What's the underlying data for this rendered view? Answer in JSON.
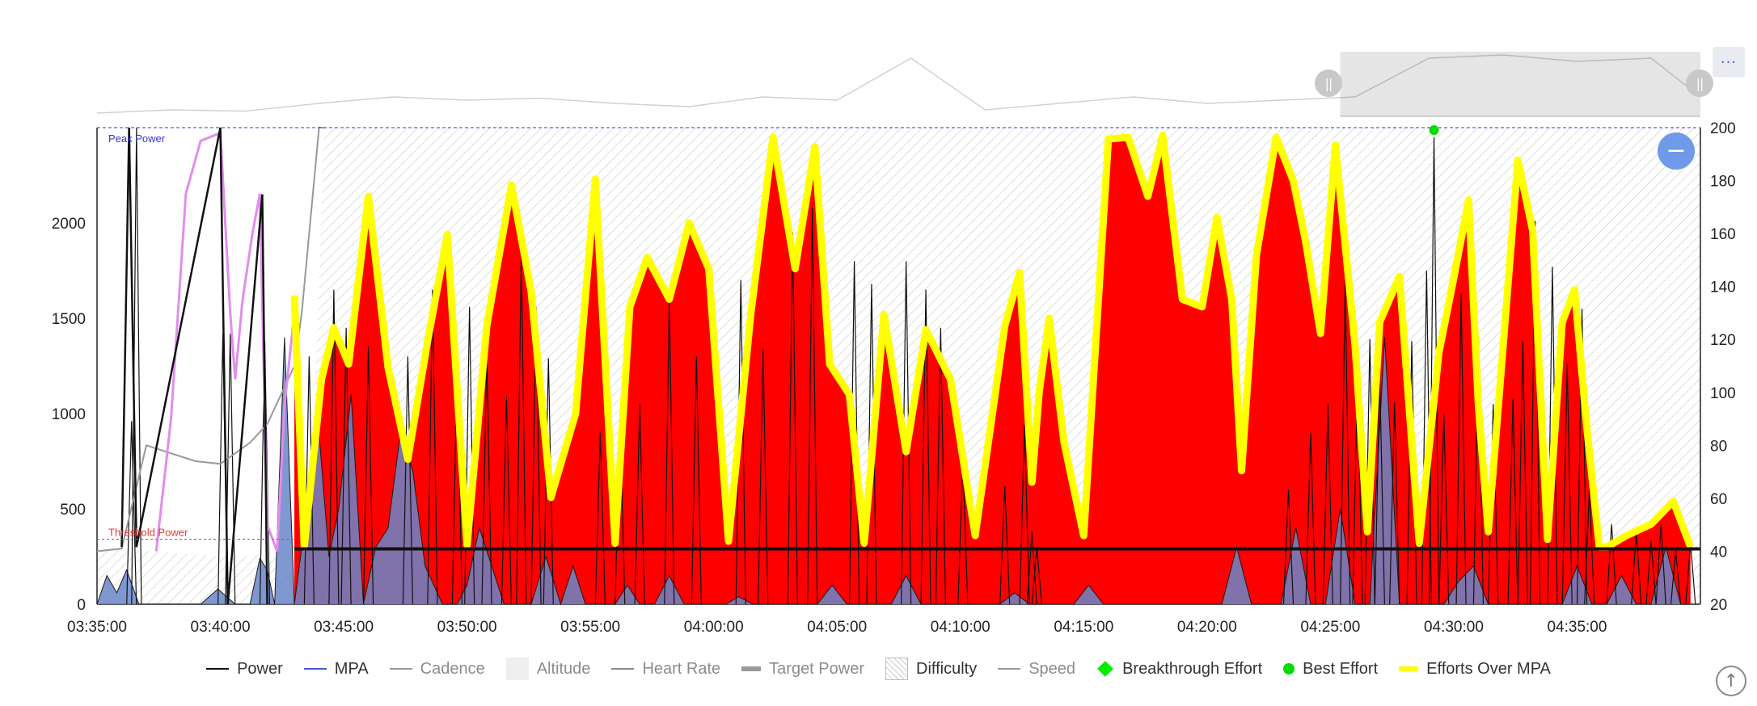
{
  "ui": {
    "menu_label": "···",
    "zoom_out_label": "−",
    "scroll_top_label": "↑",
    "handle_label": "||"
  },
  "colors": {
    "power": "#111111",
    "mpa": "#4a5bd4",
    "cadence": "#999999",
    "altitude": "#eeeeee",
    "heart_rate": "#8a8a8a",
    "target_power": "#9a9a9a",
    "speed": "#9a9a9a",
    "efforts_over_mpa": "#ffff00",
    "effort_fill": "#ff0000",
    "breakthrough": "#00ee00",
    "best_effort": "#00dd00",
    "threshold": "#e53935",
    "peak": "#3333cc",
    "hr_curve": "#e38cf0"
  },
  "legend": [
    {
      "key": "power",
      "label": "Power",
      "swatch": "line",
      "muted": false
    },
    {
      "key": "mpa",
      "label": "MPA",
      "swatch": "line",
      "muted": false
    },
    {
      "key": "cadence",
      "label": "Cadence",
      "swatch": "line",
      "muted": true
    },
    {
      "key": "altitude",
      "label": "Altitude",
      "swatch": "box",
      "muted": true
    },
    {
      "key": "heart_rate",
      "label": "Heart Rate",
      "swatch": "line",
      "muted": true
    },
    {
      "key": "target_power",
      "label": "Target Power",
      "swatch": "thick",
      "muted": true
    },
    {
      "key": "difficulty",
      "label": "Difficulty",
      "swatch": "hatch",
      "muted": false
    },
    {
      "key": "speed",
      "label": "Speed",
      "swatch": "line",
      "muted": true
    },
    {
      "key": "breakthrough",
      "label": "Breakthrough Effort",
      "swatch": "diamond",
      "muted": false
    },
    {
      "key": "best_effort",
      "label": "Best Effort",
      "swatch": "circle",
      "muted": false
    },
    {
      "key": "efforts_over_mpa",
      "label": "Efforts Over MPA",
      "swatch": "thick",
      "muted": false
    }
  ],
  "chart_data": {
    "type": "area",
    "x_axis": {
      "ticks": [
        "03:35:00",
        "03:40:00",
        "03:45:00",
        "03:50:00",
        "03:55:00",
        "04:00:00",
        "04:05:00",
        "04:10:00",
        "04:15:00",
        "04:20:00",
        "04:25:00",
        "04:30:00",
        "04:35:00"
      ],
      "start_min": 0,
      "end_min": 65
    },
    "y_axis_left": {
      "ticks": [
        0,
        500,
        1000,
        1500,
        2000
      ],
      "ylim": [
        0,
        2500
      ]
    },
    "y_axis_right": {
      "ticks": [
        20,
        40,
        60,
        80,
        100,
        120,
        140,
        160,
        180,
        200
      ],
      "ylim": [
        20,
        200
      ]
    },
    "threshold_power": {
      "label": "Threshold Power",
      "value": 290
    },
    "peak_power": {
      "label": "Peak Power",
      "value": 2500
    },
    "efforts_over_mpa": {
      "x": [
        8.0,
        8.4,
        9.1,
        9.6,
        10.2,
        11.0,
        11.8,
        12.6,
        13.4,
        14.2,
        15.0,
        15.8,
        16.8,
        17.6,
        18.4,
        19.4,
        20.2,
        21.0,
        21.6,
        22.3,
        23.2,
        24.0,
        24.8,
        25.6,
        26.5,
        27.4,
        28.3,
        29.1,
        29.7,
        30.5,
        31.1,
        31.9,
        32.8,
        33.6,
        34.6,
        35.6,
        36.8,
        37.4,
        37.9,
        38.2,
        38.6,
        39.2,
        40.0,
        41.0,
        41.8,
        42.6,
        43.2,
        44.0,
        44.8,
        45.4,
        46.0,
        46.4,
        47.0,
        47.8,
        48.5,
        49.0,
        49.6,
        50.2,
        51.0,
        51.5,
        52.0,
        52.8,
        53.6,
        54.4,
        55.0,
        55.6,
        56.0,
        56.4,
        57.0,
        57.6,
        58.2,
        58.8,
        59.4,
        59.9,
        60.4,
        60.9,
        61.2,
        62.0,
        63.0,
        63.9,
        64.6
      ],
      "y": [
        1620,
        300,
        1180,
        1450,
        1260,
        2140,
        1240,
        760,
        1380,
        1940,
        310,
        1460,
        2200,
        1640,
        560,
        1000,
        2230,
        320,
        1560,
        1820,
        1600,
        2000,
        1760,
        330,
        1520,
        2450,
        1760,
        2400,
        1260,
        1100,
        320,
        1520,
        800,
        1440,
        1180,
        360,
        1460,
        1740,
        640,
        1120,
        1500,
        850,
        360,
        2440,
        2450,
        2140,
        2460,
        1600,
        1560,
        2030,
        1600,
        700,
        1830,
        2450,
        2220,
        1900,
        1420,
        2410,
        1360,
        380,
        1480,
        1720,
        320,
        1320,
        1710,
        2120,
        1040,
        380,
        1350,
        2330,
        1960,
        340,
        1480,
        1650,
        920,
        300,
        300,
        360,
        420,
        540,
        300
      ],
      "unit_note": "power"
    },
    "power_background": {
      "x": [
        0,
        0.4,
        0.8,
        1.2,
        1.7,
        2.3,
        3.0,
        3.7,
        4.2,
        4.9,
        5.6,
        6.2,
        6.6,
        6.9,
        7.2,
        7.6,
        8.0,
        8.3,
        8.6,
        9.0,
        9.4,
        9.8,
        10.3,
        10.8,
        11.3,
        11.8,
        12.3,
        12.8,
        13.3,
        14.0,
        14.6,
        15.0,
        15.5,
        16.0,
        16.5,
        17.0,
        17.6,
        18.2,
        18.8,
        19.3,
        19.8,
        20.4,
        21.0,
        21.5,
        22.0,
        22.6,
        23.2,
        23.8,
        24.4,
        25.0,
        25.5,
        26.0,
        26.6,
        27.3,
        28.0,
        28.6,
        29.2,
        29.8,
        30.4,
        31.0,
        31.6,
        32.2,
        32.8,
        33.4,
        34.0,
        34.6,
        35.3,
        36.0,
        36.6,
        37.2,
        37.8,
        38.4,
        39.0,
        39.6,
        40.2,
        40.8,
        41.4,
        42.0,
        42.6,
        43.2,
        43.8,
        44.4,
        45.0,
        45.6,
        46.2,
        46.8,
        47.4,
        48.0,
        48.6,
        49.2,
        49.8,
        50.4,
        51.0,
        51.6,
        52.2,
        52.8,
        53.4,
        54.0,
        54.6,
        55.2,
        55.8,
        56.4,
        57.0,
        57.6,
        58.2,
        58.8,
        59.4,
        60.0,
        60.6,
        61.2,
        61.8,
        62.4,
        63.0,
        63.6,
        64.2,
        64.6,
        65.0
      ],
      "y": [
        0,
        150,
        60,
        180,
        0,
        0,
        0,
        0,
        0,
        80,
        0,
        0,
        240,
        180,
        0,
        1400,
        0,
        300,
        700,
        900,
        250,
        500,
        1100,
        0,
        300,
        400,
        900,
        700,
        200,
        0,
        0,
        100,
        400,
        200,
        0,
        0,
        0,
        250,
        0,
        200,
        0,
        0,
        0,
        100,
        0,
        0,
        150,
        0,
        0,
        0,
        0,
        40,
        0,
        0,
        0,
        0,
        0,
        100,
        0,
        0,
        0,
        0,
        150,
        0,
        0,
        0,
        0,
        0,
        0,
        60,
        0,
        0,
        0,
        0,
        100,
        0,
        0,
        0,
        0,
        0,
        0,
        0,
        0,
        0,
        300,
        0,
        0,
        0,
        400,
        0,
        0,
        500,
        0,
        0,
        1400,
        0,
        0,
        0,
        0,
        120,
        200,
        0,
        0,
        0,
        0,
        0,
        0,
        200,
        0,
        0,
        150,
        0,
        0,
        300,
        0,
        0
      ]
    },
    "power_spikes": {
      "x": [
        1.4,
        1.6,
        5.1,
        5.4,
        6.8,
        8.6,
        9.6,
        10.1,
        11.0,
        12.6,
        13.6,
        14.6,
        15.1,
        15.8,
        16.6,
        17.2,
        17.8,
        18.3,
        20.4,
        21.2,
        22.0,
        23.2,
        24.3,
        26.1,
        27.0,
        28.2,
        29.0,
        30.7,
        31.4,
        32.8,
        33.6,
        34.2,
        35.1,
        36.8,
        37.6,
        37.9,
        38.1,
        48.3,
        49.2,
        49.9,
        50.6,
        51.1,
        51.6,
        52.0,
        52.6,
        53.3,
        53.9,
        54.2,
        54.6,
        55.3,
        56.0,
        56.6,
        57.4,
        57.8,
        58.3,
        59.0,
        59.6,
        60.2,
        60.5,
        61.4,
        62.4,
        63.0,
        63.4,
        64.0,
        64.6
      ],
      "y": [
        960,
        2500,
        1420,
        1420,
        1380,
        1300,
        1650,
        1450,
        1350,
        1300,
        1650,
        1280,
        1560,
        1320,
        1090,
        1850,
        1560,
        1290,
        900,
        1000,
        1050,
        1600,
        1300,
        1700,
        1340,
        1950,
        2080,
        1800,
        1680,
        1800,
        1650,
        1450,
        760,
        620,
        940,
        380,
        300,
        600,
        900,
        1050,
        1700,
        1220,
        1390,
        1200,
        1060,
        1380,
        1750,
        2450,
        1000,
        1630,
        1400,
        1050,
        1080,
        1380,
        2010,
        1770,
        1260,
        1550,
        600,
        420,
        380,
        330,
        420,
        280,
        320
      ]
    },
    "hr_curve": {
      "x": [
        2.4,
        3.0,
        3.6,
        4.2,
        5.0,
        5.4,
        5.6,
        5.9,
        6.3,
        6.6,
        6.9,
        7.3,
        7.6,
        8.0
      ],
      "y": [
        40,
        90,
        175,
        195,
        198,
        130,
        105,
        135,
        160,
        175,
        50,
        40,
        95,
        130
      ],
      "unit_note": "bpm"
    },
    "cadence_curve": {
      "x": [
        0,
        1.0,
        2.0,
        3.0,
        4.0,
        5.0,
        5.6,
        6.2,
        6.9,
        7.6,
        8.0,
        8.3,
        8.6,
        9.0,
        9.2
      ],
      "y": [
        40,
        41,
        80,
        77,
        74,
        73,
        77,
        81,
        88,
        102,
        110,
        130,
        160,
        200,
        200
      ],
      "unit_note": "right-axis"
    },
    "minimap": {
      "x": [
        0,
        3,
        6,
        9,
        12,
        15,
        18,
        21,
        24,
        27,
        30,
        33,
        36,
        39,
        42,
        45,
        48,
        51,
        54,
        57,
        60,
        63,
        65
      ],
      "y": [
        0.05,
        0.1,
        0.08,
        0.2,
        0.3,
        0.25,
        0.28,
        0.2,
        0.15,
        0.3,
        0.25,
        0.9,
        0.1,
        0.2,
        0.3,
        0.2,
        0.25,
        0.3,
        0.9,
        0.95,
        0.85,
        0.9,
        0.3
      ]
    }
  }
}
